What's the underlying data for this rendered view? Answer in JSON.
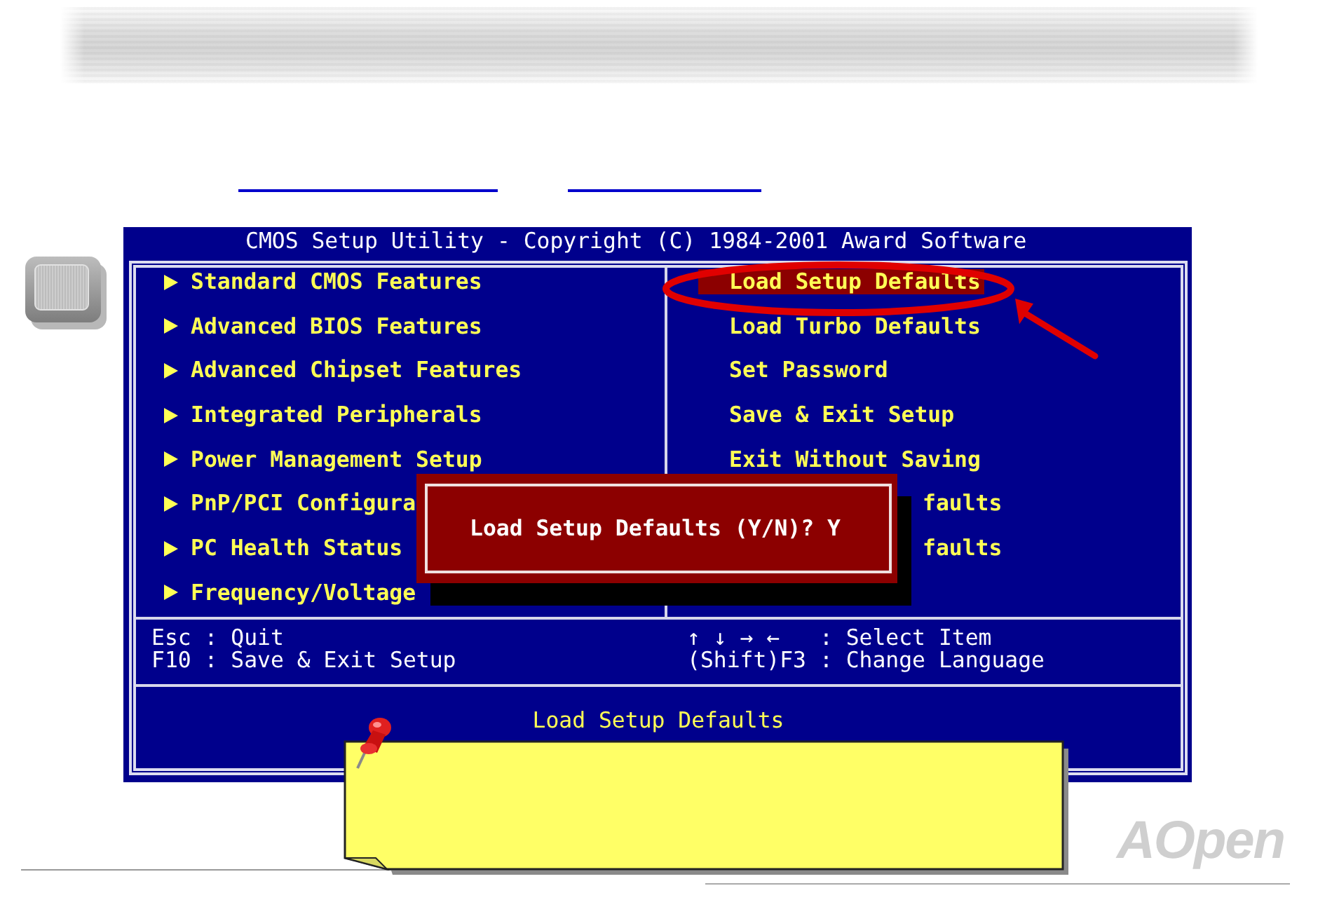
{
  "bios": {
    "title": "CMOS Setup Utility - Copyright (C) 1984-2001 Award Software",
    "left_menu": [
      {
        "label": "Standard CMOS Features",
        "selected": false
      },
      {
        "label": "Advanced BIOS Features",
        "selected": false
      },
      {
        "label": "Advanced Chipset Features",
        "selected": false
      },
      {
        "label": "Integrated Peripherals",
        "selected": false
      },
      {
        "label": "Power Management Setup",
        "selected": false
      },
      {
        "label": "PnP/PCI Configura",
        "selected": false
      },
      {
        "label": "PC Health Status",
        "selected": false
      },
      {
        "label": "Frequency/Voltage",
        "selected": false
      }
    ],
    "right_menu": [
      {
        "label": "Load Setup Defaults",
        "selected": true,
        "kind": "option"
      },
      {
        "label": "Load Turbo Defaults",
        "selected": false,
        "kind": "option"
      },
      {
        "label": "Set Password",
        "selected": false,
        "kind": "option"
      },
      {
        "label": "Save & Exit Setup",
        "selected": false,
        "kind": "option"
      },
      {
        "label": "Exit Without Saving",
        "selected": false,
        "kind": "option"
      },
      {
        "label": "faults",
        "selected": false,
        "kind": "covered"
      },
      {
        "label": "faults",
        "selected": false,
        "kind": "covered"
      }
    ],
    "help_left": [
      "Esc : Quit",
      "F10 : Save & Exit Setup"
    ],
    "help_right": [
      "↑ ↓ → ←   : Select Item",
      "(Shift)F3 : Change Language"
    ],
    "status": "Load Setup Defaults",
    "dialog": {
      "prompt": "Load Setup Defaults (Y/N)? Y"
    }
  },
  "logo": "AOpen"
}
